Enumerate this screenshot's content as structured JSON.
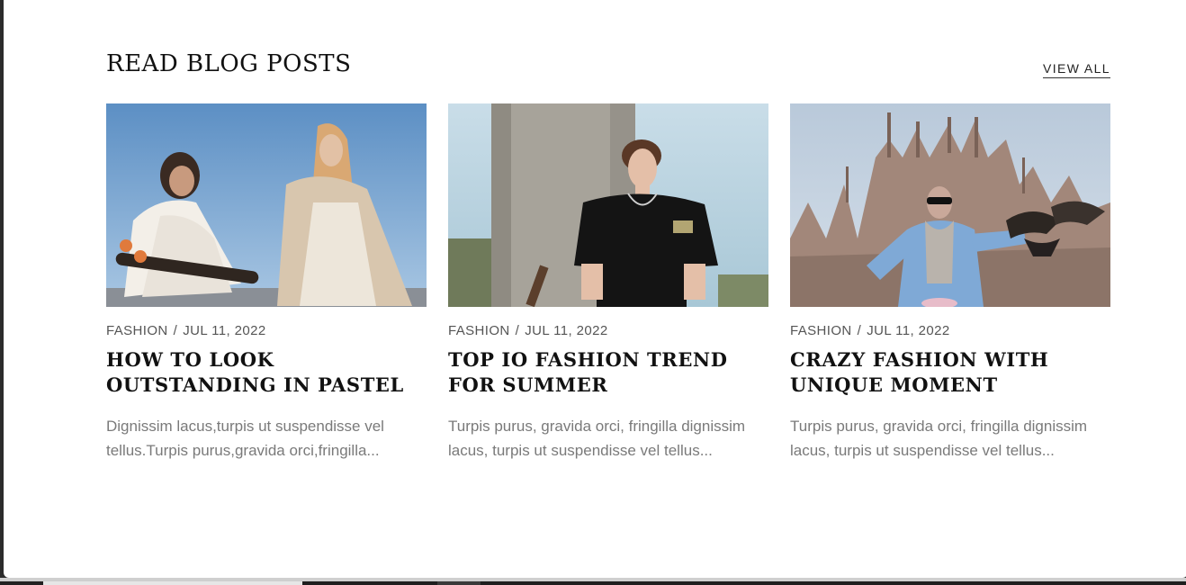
{
  "section": {
    "title": "READ BLOG POSTS",
    "view_all": "VIEW ALL"
  },
  "posts": [
    {
      "category": "FASHION",
      "separator": "/",
      "date": "JUL 11, 2022",
      "title": "HOW TO LOOK OUTSTANDING IN PASTEL",
      "excerpt": "Dignissim lacus,turpis ut suspendisse vel tellus.Turpis purus,gravida orci,fringilla..."
    },
    {
      "category": "FASHION",
      "separator": "/",
      "date": "JUL 11, 2022",
      "title": "TOP IO FASHION TREND FOR SUMMER",
      "excerpt": "Turpis purus, gravida orci, fringilla dignissim lacus, turpis ut suspendisse vel tellus..."
    },
    {
      "category": "FASHION",
      "separator": "/",
      "date": "JUL 11, 2022",
      "title": "CRAZY FASHION WITH UNIQUE MOMENT",
      "excerpt": "Turpis purus, gravida orci, fringilla dignissim lacus, turpis ut suspendisse vel tellus..."
    }
  ],
  "colors": {
    "background": "#ffffff",
    "title_text": "#111111",
    "meta_text": "#555555",
    "excerpt_text": "#7a7a7a"
  }
}
